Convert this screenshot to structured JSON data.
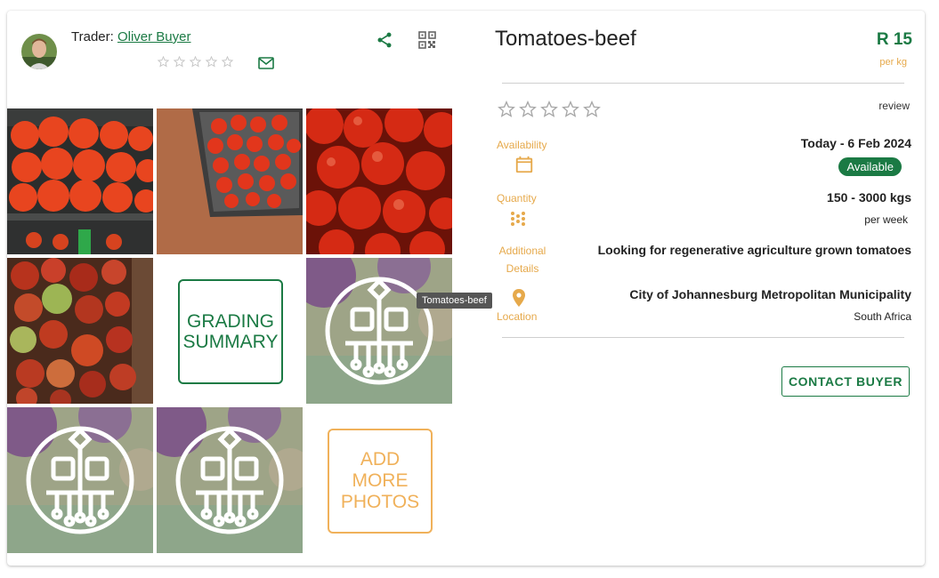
{
  "trader": {
    "prefix": "Trader:",
    "name": "Oliver Buyer",
    "rating": 0
  },
  "product": {
    "title": "Tomatoes-beef",
    "price": "R 15",
    "price_unit": "per kg",
    "review_label": "review",
    "availability_label": "Availability",
    "availability_value": "Today - 6 Feb 2024",
    "availability_status": "Available",
    "quantity_label": "Quantity",
    "quantity_value": "150 - 3000 kgs",
    "quantity_period": "per week",
    "details_label_1": "Additional",
    "details_label_2": "Details",
    "details_value": "Looking for regenerative agriculture grown tomatoes",
    "location_label": "Location",
    "location_city": "City of Johannesburg Metropolitan Municipality",
    "location_country": "South Africa"
  },
  "gallery": {
    "grading_line1": "GRADING",
    "grading_line2": "SUMMARY",
    "add_line1": "ADD",
    "add_line2": "MORE",
    "add_line3": "PHOTOS",
    "tooltip": "Tomatoes-beef"
  },
  "actions": {
    "contact": "CONTACT BUYER"
  },
  "colors": {
    "brand_green": "#1b7a44",
    "accent_orange": "#e6a94b"
  },
  "icons": [
    "share-icon",
    "qr-code-icon",
    "mail-icon",
    "calendar-icon",
    "grain-icon",
    "location-pin-icon",
    "star-outline-icon"
  ]
}
